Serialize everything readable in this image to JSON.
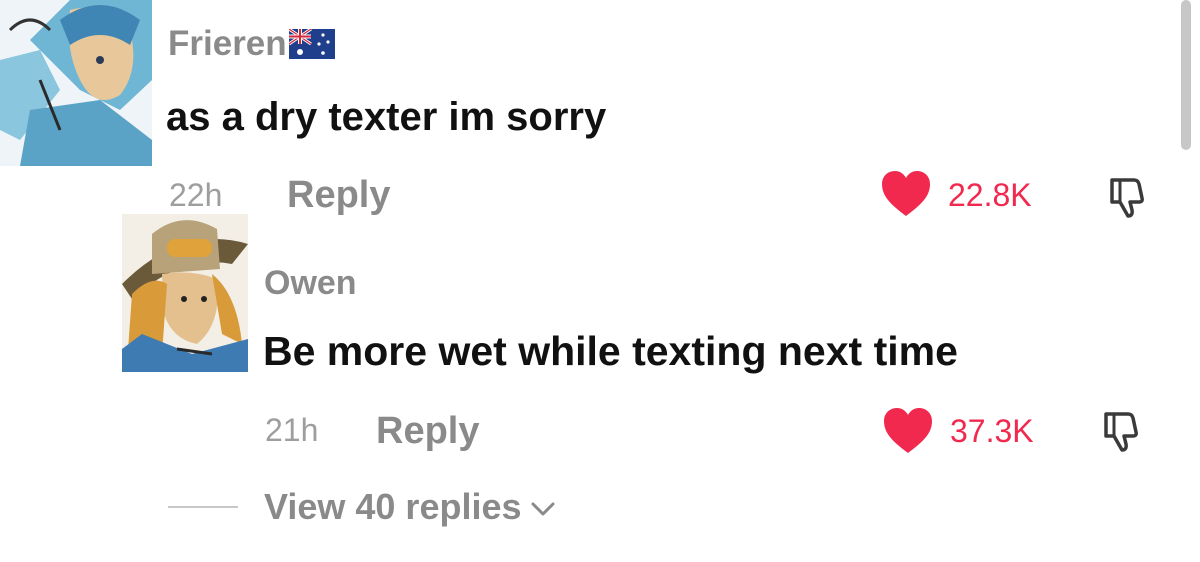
{
  "comments": [
    {
      "username": "Frieren",
      "flag_icon": "australia-flag-icon",
      "text": "as a dry texter im sorry",
      "timestamp": "22h",
      "reply_label": "Reply",
      "likes": "22.8K",
      "avatar_icon": "anime-avatar-icon"
    },
    {
      "username": "Owen",
      "text": "Be more wet while texting next time",
      "timestamp": "21h",
      "reply_label": "Reply",
      "likes": "37.3K",
      "avatar_icon": "anime-avatar-icon"
    }
  ],
  "view_replies_label": "View 40 replies",
  "colors": {
    "heart": "#f2294f",
    "muted_text": "#8a8a8a",
    "body_text": "#111111"
  }
}
